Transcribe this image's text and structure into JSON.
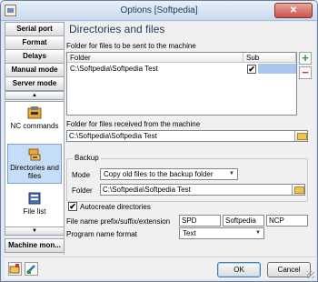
{
  "window": {
    "title": "Options [Softpedia]",
    "close_label": "✕"
  },
  "sidebar": {
    "buttons": [
      "Serial port",
      "Format",
      "Delays",
      "Manual mode",
      "Server mode"
    ],
    "bottom_button": "Machine mon...",
    "items": [
      {
        "label": "NC commands",
        "icon": "nc-commands-icon"
      },
      {
        "label": "Directories and files",
        "icon": "folder-files-icon",
        "selected": true
      },
      {
        "label": "File list",
        "icon": "file-list-icon"
      }
    ],
    "scroll_up": "▲",
    "scroll_down": "▼"
  },
  "main": {
    "heading": "Directories and files",
    "send_label": "Folder for files to be sent to the machine",
    "list_columns": [
      "Folder",
      "Sub"
    ],
    "list_rows": [
      {
        "folder": "C:\\Softpedia\\Softpedia Test",
        "sub_checked": true,
        "check": "✔"
      }
    ],
    "add_label": "+",
    "remove_label": "−",
    "receive_label": "Folder for files received from the machine",
    "receive_value": "C:\\Softpedia\\Softpedia Test",
    "backup": {
      "label": "Backup",
      "mode_label": "Mode",
      "mode_value": "Copy old files to the backup folder",
      "folder_label": "Folder",
      "folder_value": "C:\\Softpedia\\Softpedia Test"
    },
    "autocreate_label": "Autocreate directories",
    "autocreate_checked": true,
    "autocreate_check": "✔",
    "prefix_label": "File name prefix/suffix/extension",
    "prefix_value": "SPD",
    "suffix_value": "Softpedia",
    "extension_value": "NCP",
    "program_format_label": "Program name format",
    "program_format_value": "Text",
    "combo_arrow": "▼"
  },
  "footer": {
    "ok_label": "OK",
    "cancel_label": "Cancel"
  },
  "colors": {
    "add": "#2e9b2e",
    "remove": "#d23b2b",
    "title_text": "#1e395b"
  }
}
